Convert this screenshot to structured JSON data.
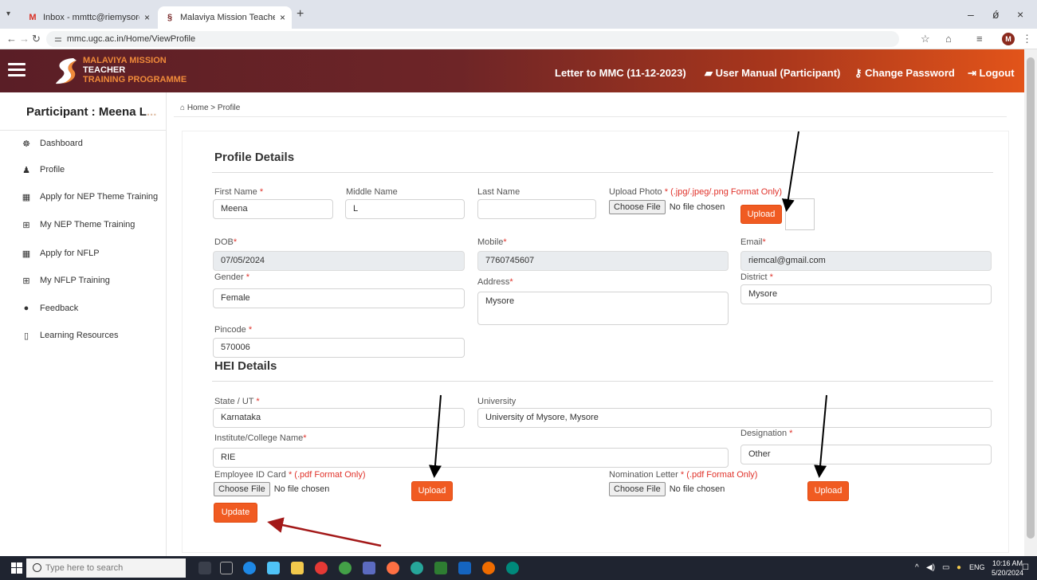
{
  "browser": {
    "tabs": [
      {
        "title": "Inbox - mmttc@riemysore.ac.in",
        "icon": "gmail-icon",
        "close": "×"
      },
      {
        "title": "Malaviya Mission Teacher Traini",
        "icon": "site-logo-icon",
        "close": "×"
      }
    ],
    "new_tab": "+",
    "url": "mmc.ugc.ac.in/Home/ViewProfile",
    "profile_initial": "M",
    "window_controls": {
      "minimize": "–",
      "maximize": "ǿ",
      "close": "×"
    }
  },
  "header": {
    "logo": {
      "line1": "MALAVIYA MISSION",
      "line2": "TEACHER",
      "line3": "TRAINING PROGRAMME"
    },
    "links": [
      {
        "label": "Letter to MMC (11-12-2023)",
        "icon": ""
      },
      {
        "label": "User Manual (Participant)",
        "icon": "book-icon"
      },
      {
        "label": "Change Password",
        "icon": "key-icon"
      },
      {
        "label": "Logout",
        "icon": "logout-icon"
      }
    ],
    "colors": {
      "gradient_start": "#5a1e26",
      "gradient_end": "#e2541a",
      "accent": "#f05b22"
    }
  },
  "sidebar": {
    "participant_prefix": "Participant : Meena L",
    "participant_fade": "...",
    "items": [
      {
        "label": "Dashboard",
        "icon": "dashboard-icon",
        "glyph": "☸"
      },
      {
        "label": "Profile",
        "icon": "user-icon",
        "glyph": "♟"
      },
      {
        "label": "Apply for NEP Theme Training",
        "icon": "calendar-check-icon",
        "glyph": "▦"
      },
      {
        "label": "My NEP Theme Training",
        "icon": "grid-icon",
        "glyph": "⊞"
      },
      {
        "label": "Apply for NFLP",
        "icon": "calendar-icon",
        "glyph": "▦"
      },
      {
        "label": "My NFLP Training",
        "icon": "grid-icon",
        "glyph": "⊞"
      },
      {
        "label": "Feedback",
        "icon": "comment-icon",
        "glyph": "●"
      },
      {
        "label": "Learning Resources",
        "icon": "book-icon",
        "glyph": "▯"
      }
    ]
  },
  "breadcrumb": {
    "home": "Home",
    "separator": ">",
    "current": "Profile"
  },
  "profile": {
    "section_title": "Profile Details",
    "first_name": {
      "label": "First Name",
      "value": "Meena"
    },
    "middle_name": {
      "label": "Middle Name",
      "value": "L"
    },
    "last_name": {
      "label": "Last Name",
      "value": ""
    },
    "photo": {
      "label": "Upload Photo",
      "note": "(.jpg/.jpeg/.png Format Only)",
      "choose": "Choose File",
      "status": "No file chosen",
      "upload": "Upload"
    },
    "dob": {
      "label": "DOB",
      "value": "07/05/2024"
    },
    "mobile": {
      "label": "Mobile",
      "value": "7760745607"
    },
    "email": {
      "label": "Email",
      "value": "riemcal@gmail.com"
    },
    "gender": {
      "label": "Gender",
      "value": "Female"
    },
    "address": {
      "label": "Address",
      "value": "Mysore"
    },
    "district": {
      "label": "District",
      "value": "Mysore"
    },
    "pincode": {
      "label": "Pincode",
      "value": "570006"
    }
  },
  "hei": {
    "section_title": "HEI Details",
    "state": {
      "label": "State / UT",
      "value": "Karnataka"
    },
    "university": {
      "label": "University",
      "value": "University of Mysore, Mysore"
    },
    "institute": {
      "label": "Institute/College Name",
      "value": "RIE"
    },
    "designation": {
      "label": "Designation",
      "value": "Other"
    },
    "employee_id": {
      "label": "Employee ID Card",
      "note": "(.pdf Format Only)",
      "choose": "Choose File",
      "status": "No file chosen",
      "upload": "Upload"
    },
    "nomination": {
      "label": "Nomination Letter",
      "note": "(.pdf Format Only)",
      "choose": "Choose File",
      "status": "No file chosen",
      "upload": "Upload"
    },
    "update": "Update"
  },
  "taskbar": {
    "search_placeholder": "Type here to search",
    "language": "ENG",
    "time": "10:16 AM",
    "date": "5/20/2024"
  }
}
